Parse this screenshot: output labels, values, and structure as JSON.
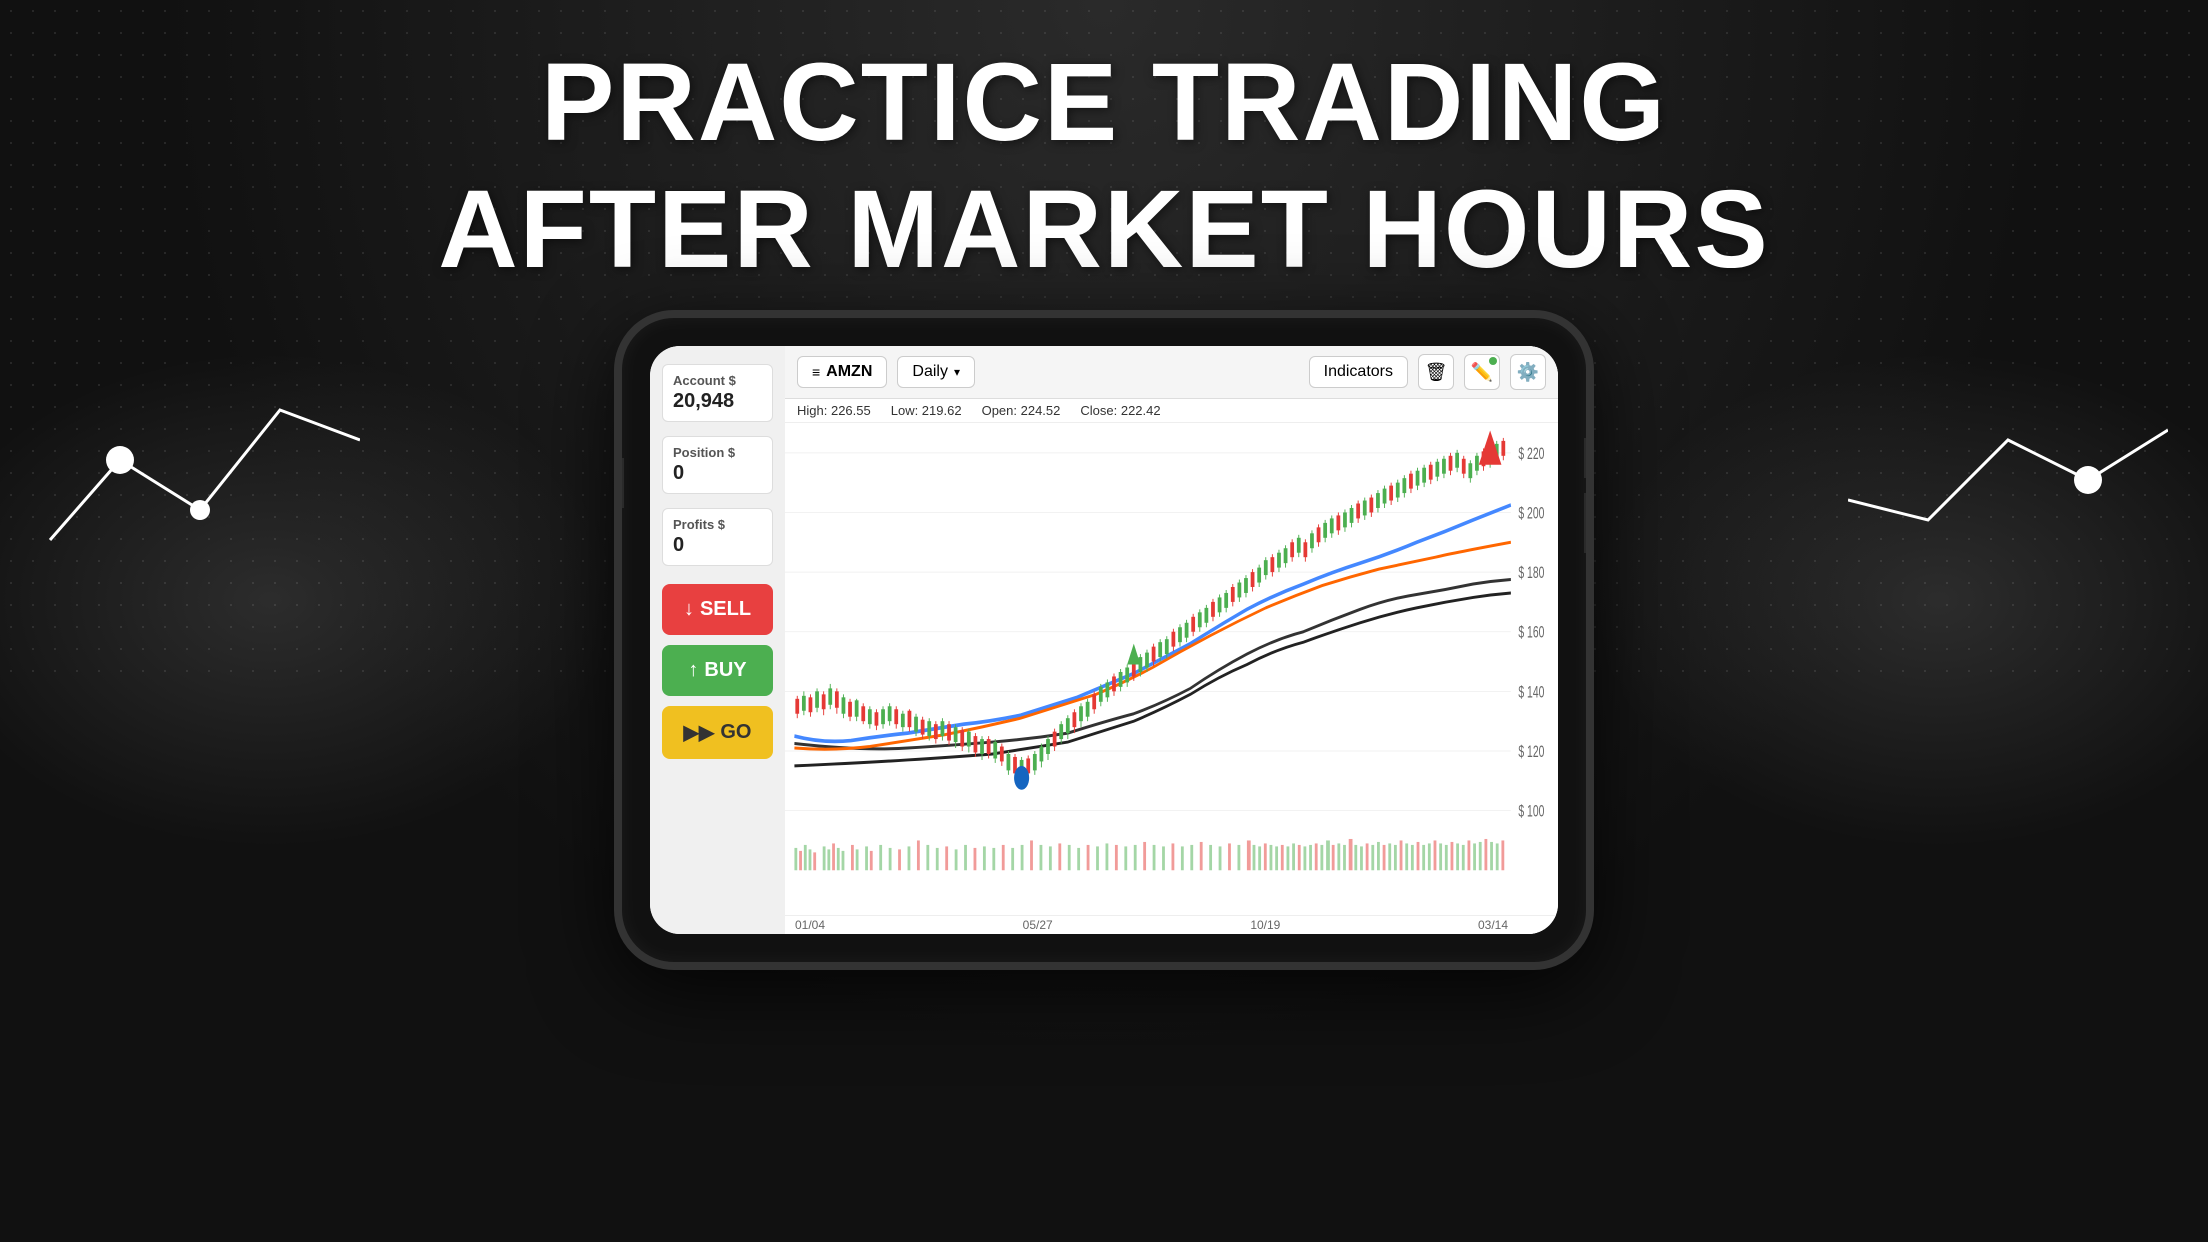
{
  "title_line1": "PRACTICE TRADING",
  "title_line2": "AFTER MARKET HOURS",
  "phone": {
    "left_panel": {
      "account_label": "Account $",
      "account_value": "20,948",
      "position_label": "Position $",
      "position_value": "0",
      "profits_label": "Profits $",
      "profits_value": "0",
      "sell_btn": "SELL",
      "buy_btn": "BUY",
      "go_btn": "GO"
    },
    "toolbar": {
      "ticker": "AMZN",
      "period": "Daily",
      "indicators": "Indicators",
      "period_dropdown": "▾"
    },
    "price_bar": {
      "high": "High: 226.55",
      "low": "Low: 219.62",
      "open": "Open: 224.52",
      "close": "Close: 222.42"
    },
    "chart": {
      "y_labels": [
        "$ 220",
        "$ 200",
        "$ 180",
        "$ 160",
        "$ 140",
        "$ 120",
        "$ 100"
      ],
      "x_labels": [
        "01/04",
        "05/27",
        "10/19",
        "03/14"
      ]
    }
  }
}
